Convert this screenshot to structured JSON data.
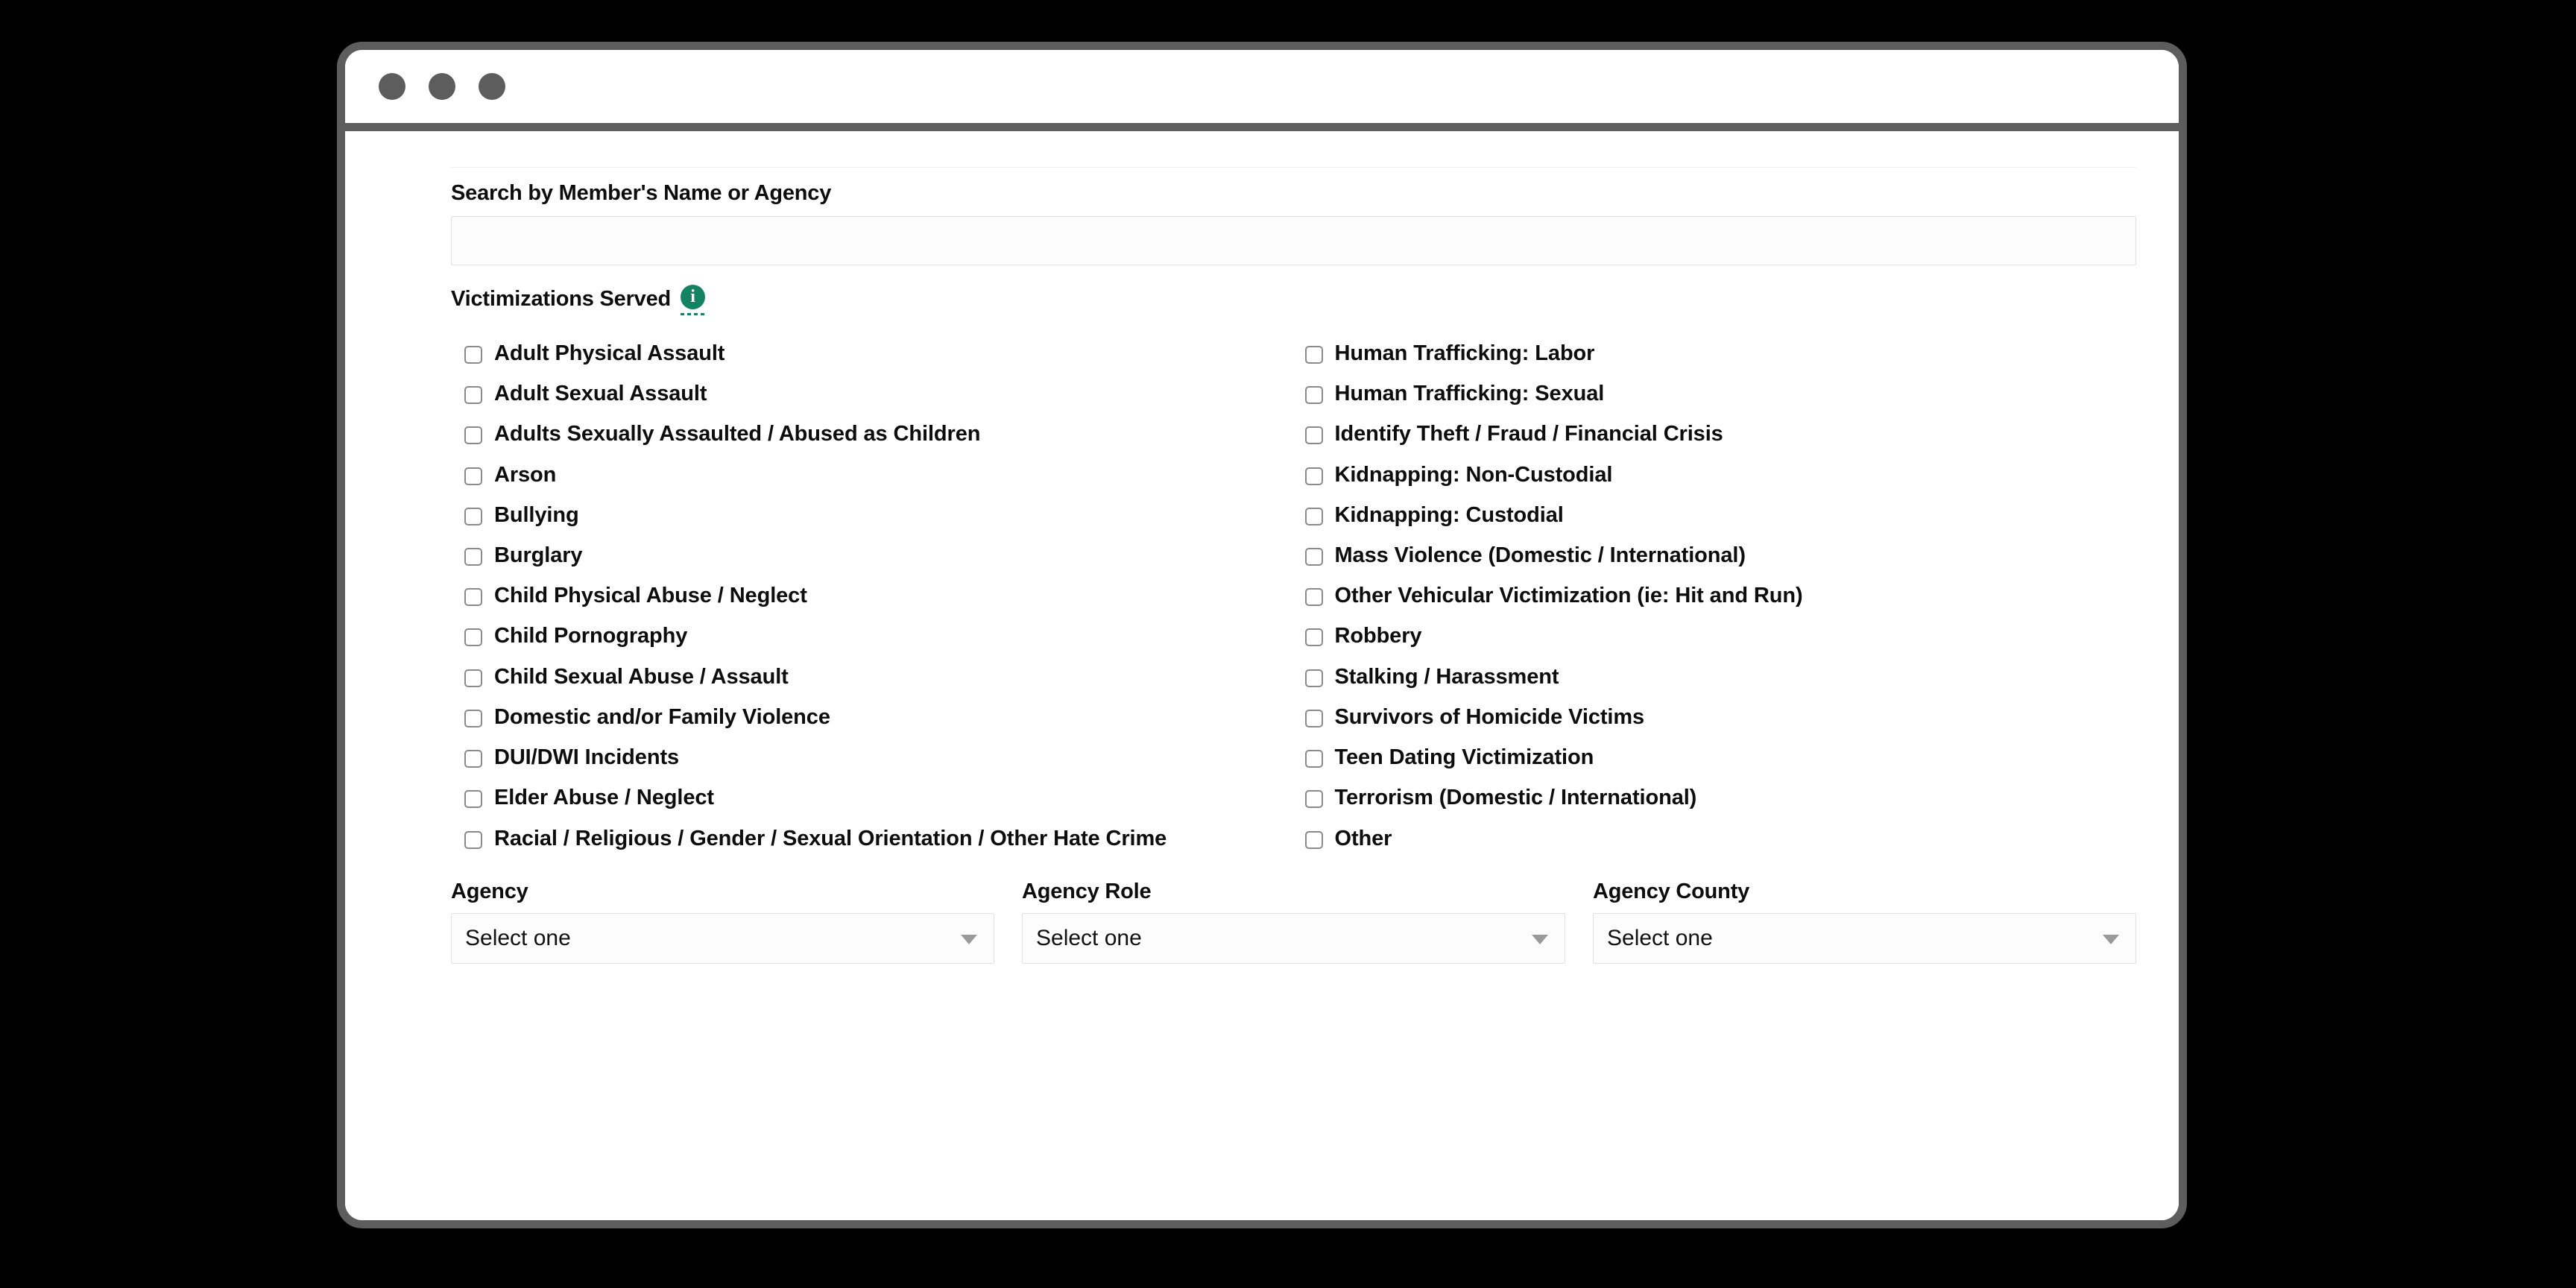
{
  "window": {
    "traffic_lights": [
      "close-dot",
      "minimize-dot",
      "maximize-dot"
    ]
  },
  "form": {
    "search": {
      "label": "Search by Member's Name or Agency",
      "value": "",
      "placeholder": ""
    },
    "victimizations": {
      "label": "Victimizations Served",
      "info_icon": "info-icon",
      "info_glyph": "i",
      "accent_color": "#128363",
      "left_column": [
        "Adult Physical Assault",
        "Adult Sexual Assault",
        "Adults Sexually Assaulted / Abused as Children",
        "Arson",
        "Bullying",
        "Burglary",
        "Child Physical Abuse / Neglect",
        "Child Pornography",
        "Child Sexual Abuse / Assault",
        "Domestic and/or Family Violence",
        "DUI/DWI Incidents",
        "Elder Abuse / Neglect",
        "Racial / Religious / Gender / Sexual Orientation / Other Hate Crime"
      ],
      "right_column": [
        "Human Trafficking: Labor",
        "Human Trafficking: Sexual",
        "Identify Theft / Fraud / Financial Crisis",
        "Kidnapping: Non-Custodial",
        "Kidnapping: Custodial",
        "Mass Violence (Domestic / International)",
        "Other Vehicular Victimization (ie: Hit and Run)",
        "Robbery",
        "Stalking / Harassment",
        "Survivors of Homicide Victims",
        "Teen Dating Victimization",
        "Terrorism (Domestic / International)",
        "Other"
      ]
    },
    "selects": [
      {
        "label": "Agency",
        "value": "Select one",
        "caret": "chevron-down-icon"
      },
      {
        "label": "Agency Role",
        "value": "Select one",
        "caret": "chevron-down-icon"
      },
      {
        "label": "Agency County",
        "value": "Select one",
        "caret": "chevron-down-icon"
      }
    ]
  }
}
